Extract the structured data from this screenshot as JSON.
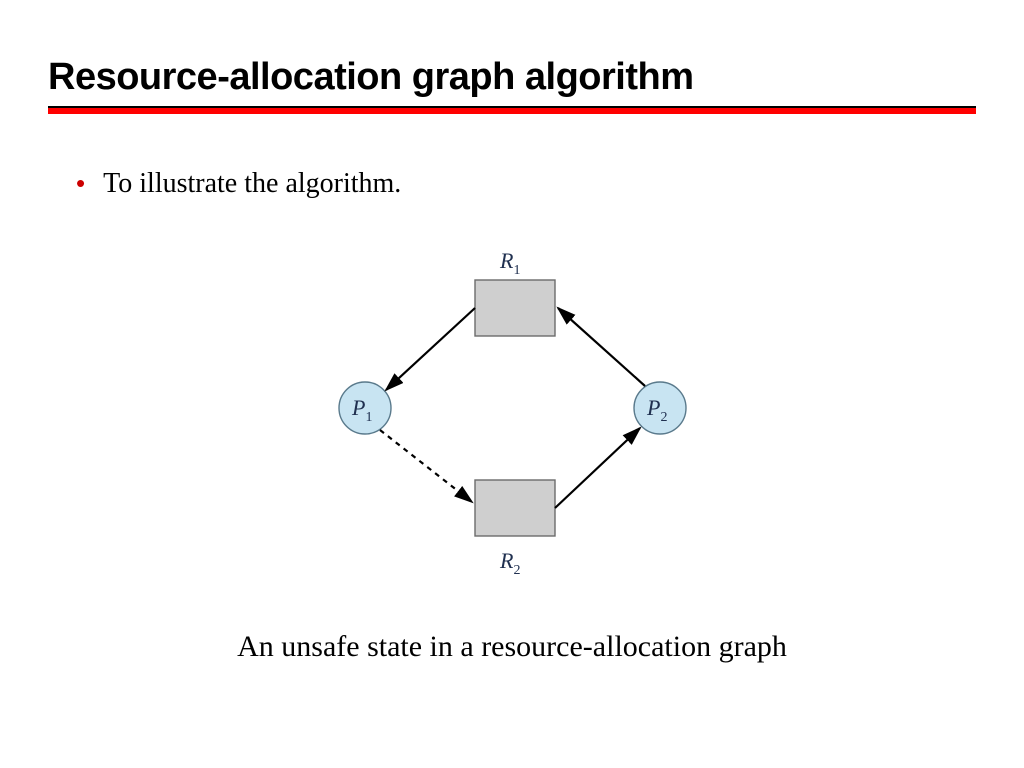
{
  "title": "Resource-allocation graph algorithm",
  "bullet": "To illustrate the algorithm.",
  "caption": "An unsafe state in a resource-allocation graph",
  "diagram": {
    "R1": {
      "letter": "R",
      "sub": "1"
    },
    "R2": {
      "letter": "R",
      "sub": "2"
    },
    "P1": {
      "letter": "P",
      "sub": "1"
    },
    "P2": {
      "letter": "P",
      "sub": "2"
    }
  },
  "colors": {
    "accent_red": "#ff0000",
    "bullet_red": "#cc0000",
    "box_fill": "#cfcfcf",
    "circle_fill": "#c8e4f2"
  }
}
